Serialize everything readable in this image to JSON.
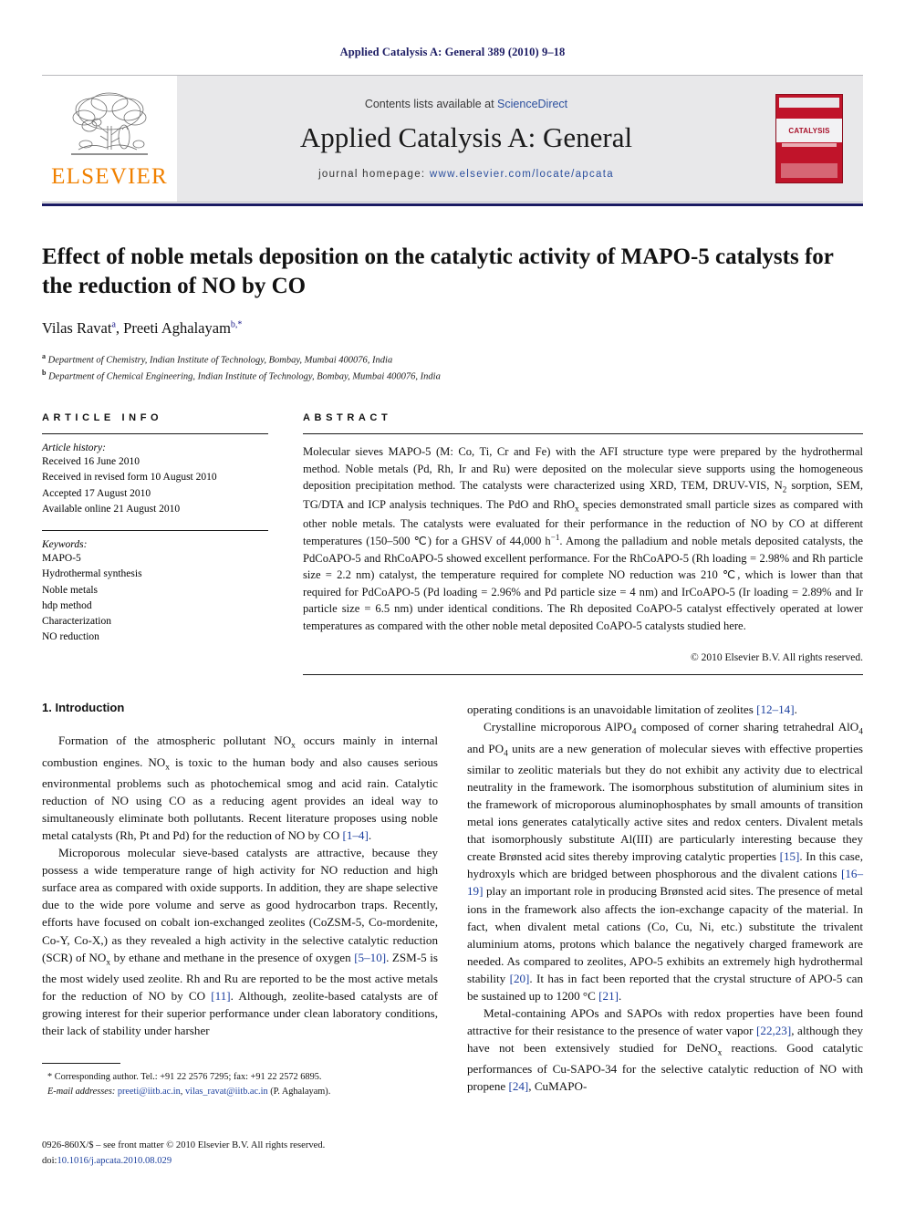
{
  "running_head": "Applied Catalysis A: General 389 (2010) 9–18",
  "banner": {
    "contents_prefix": "Contents lists available at ",
    "contents_link": "ScienceDirect",
    "journal_title": "Applied Catalysis A: General",
    "homepage_label": "journal homepage: ",
    "homepage_url": "www.elsevier.com/locate/apcata",
    "publisher_name": "ELSEVIER",
    "cover_label": "CATALYSIS",
    "accent_orange": "#f08000",
    "cover_red": "#c0142a",
    "link_blue": "#2b4f9e"
  },
  "article": {
    "title": "Effect of noble metals deposition on the catalytic activity of MAPO-5 catalysts for the reduction of NO by CO",
    "authors_html": "Vilas Ravat<sup>a</sup>, Preeti Aghalayam<sup>b,*</sup>",
    "affiliations": [
      {
        "marker": "a",
        "text": "Department of Chemistry, Indian Institute of Technology, Bombay, Mumbai 400076, India"
      },
      {
        "marker": "b",
        "text": "Department of Chemical Engineering, Indian Institute of Technology, Bombay, Mumbai 400076, India"
      }
    ]
  },
  "article_info": {
    "heading": "ARTICLE INFO",
    "history_label": "Article history:",
    "history": [
      "Received 16 June 2010",
      "Received in revised form 10 August 2010",
      "Accepted 17 August 2010",
      "Available online 21 August 2010"
    ],
    "keywords_label": "Keywords:",
    "keywords": [
      "MAPO-5",
      "Hydrothermal synthesis",
      "Noble metals",
      "hdp method",
      "Characterization",
      "NO reduction"
    ]
  },
  "abstract": {
    "heading": "ABSTRACT",
    "text_html": "Molecular sieves MAPO-5 (M: Co, Ti, Cr and Fe) with the AFI structure type were prepared by the hydrothermal method. Noble metals (Pd, Rh, Ir and Ru) were deposited on the molecular sieve supports using the homogeneous deposition precipitation method. The catalysts were characterized using XRD, TEM, DRUV-VIS, N<sub>2</sub> sorption, SEM, TG/DTA and ICP analysis techniques. The PdO and RhO<sub>x</sub> species demonstrated small particle sizes as compared with other noble metals. The catalysts were evaluated for their performance in the reduction of NO by CO at different temperatures (150–500 &#8451;) for a GHSV of 44,000 h<sup>&#8722;1</sup>. Among the palladium and noble metals deposited catalysts, the PdCoAPO-5 and RhCoAPO-5 showed excellent performance. For the RhCoAPO-5 (Rh loading = 2.98% and Rh particle size = 2.2 nm) catalyst, the temperature required for complete NO reduction was 210 &#8451;, which is lower than that required for PdCoAPO-5 (Pd loading = 2.96% and Pd particle size = 4 nm) and IrCoAPO-5 (Ir loading = 2.89% and Ir particle size = 6.5 nm) under identical conditions. The Rh deposited CoAPO-5 catalyst effectively operated at lower temperatures as compared with the other noble metal deposited CoAPO-5 catalysts studied here.",
    "copyright": "© 2010 Elsevier B.V. All rights reserved."
  },
  "body": {
    "section_heading": "1. Introduction",
    "left_paragraphs": [
      "Formation of the atmospheric pollutant NO<sub>x</sub> occurs mainly in internal combustion engines. NO<sub>x</sub> is toxic to the human body and also causes serious environmental problems such as photochemical smog and acid rain. Catalytic reduction of NO using CO as a reducing agent provides an ideal way to simultaneously eliminate both pollutants. Recent literature proposes using noble metal catalysts (Rh, Pt and Pd) for the reduction of NO by CO <span class=\"ref\">[1–4]</span>.",
      "Microporous molecular sieve-based catalysts are attractive, because they possess a wide temperature range of high activity for NO reduction and high surface area as compared with oxide supports. In addition, they are shape selective due to the wide pore volume and serve as good hydrocarbon traps. Recently, efforts have focused on cobalt ion-exchanged zeolites (CoZSM-5, Co-mordenite, Co-Y, Co-X,) as they revealed a high activity in the selective catalytic reduction (SCR) of NO<sub>x</sub> by ethane and methane in the presence of oxygen <span class=\"ref\">[5–10]</span>. ZSM-5 is the most widely used zeolite. Rh and Ru are reported to be the most active metals for the reduction of NO by CO <span class=\"ref\">[11]</span>. Although, zeolite-based catalysts are of growing interest for their superior performance under clean laboratory conditions, their lack of stability under harsher"
    ],
    "right_paragraphs": [
      "operating conditions is an unavoidable limitation of zeolites <span class=\"ref\">[12–14]</span>.",
      "Crystalline microporous AlPO<sub>4</sub> composed of corner sharing tetrahedral AlO<sub>4</sub> and PO<sub>4</sub> units are a new generation of molecular sieves with effective properties similar to zeolitic materials but they do not exhibit any activity due to electrical neutrality in the framework. The isomorphous substitution of aluminium sites in the framework of microporous aluminophosphates by small amounts of transition metal ions generates catalytically active sites and redox centers. Divalent metals that isomorphously substitute Al(III) are particularly interesting because they create Brønsted acid sites thereby improving catalytic properties <span class=\"ref\">[15]</span>. In this case, hydroxyls which are bridged between phosphorous and the divalent cations <span class=\"ref\">[16–19]</span> play an important role in producing Brønsted acid sites. The presence of metal ions in the framework also affects the ion-exchange capacity of the material. In fact, when divalent metal cations (Co, Cu, Ni, etc.) substitute the trivalent aluminium atoms, protons which balance the negatively charged framework are needed. As compared to zeolites, APO-5 exhibits an extremely high hydrothermal stability <span class=\"ref\">[20]</span>. It has in fact been reported that the crystal structure of APO-5 can be sustained up to 1200 °C <span class=\"ref\">[21]</span>.",
      "Metal-containing APOs and SAPOs with redox properties have been found attractive for their resistance to the presence of water vapor <span class=\"ref\">[22,23]</span>, although they have not been extensively studied for DeNO<sub>x</sub> reactions. Good catalytic performances of Cu-SAPO-34 for the selective catalytic reduction of NO with propene <span class=\"ref\">[24]</span>, CuMAPO-"
    ]
  },
  "footnote": {
    "marker": "*",
    "line1": "Corresponding author. Tel.: +91 22 2576 7295; fax: +91 22 2572 6895.",
    "emails_label": "E-mail addresses:",
    "email1": "preeti@iitb.ac.in",
    "email2": "vilas_ravat@iitb.ac.in",
    "email_suffix": "(P. Aghalayam)."
  },
  "page_footer": {
    "issn_line": "0926-860X/$ – see front matter © 2010 Elsevier B.V. All rights reserved.",
    "doi_label": "doi:",
    "doi_value": "10.1016/j.apcata.2010.08.029"
  }
}
